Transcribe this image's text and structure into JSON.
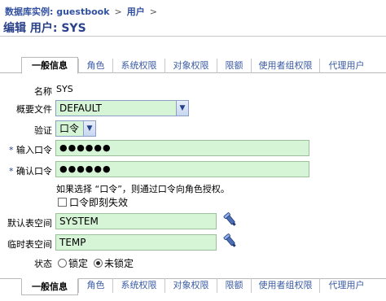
{
  "breadcrumb": {
    "items": [
      "数据库实例: guestbook",
      "用户"
    ],
    "separator": ">"
  },
  "header": {
    "title": "编辑 用户: SYS"
  },
  "tabs": [
    {
      "label": "一般信息",
      "active": true
    },
    {
      "label": "角色"
    },
    {
      "label": "系统权限"
    },
    {
      "label": "对象权限"
    },
    {
      "label": "限额"
    },
    {
      "label": "使用者组权限"
    },
    {
      "label": "代理用户"
    }
  ],
  "form": {
    "name_label": "名称",
    "name_value": "SYS",
    "profile_label": "概要文件",
    "profile_value": "DEFAULT",
    "auth_label": "验证",
    "auth_value": "口令",
    "password_label": "输入口令",
    "password_value": "●●●●●●",
    "confirm_label": "确认口令",
    "confirm_value": "●●●●●●",
    "required_marker": "*",
    "hint": "如果选择 “口令”，则通过口令向角色授权。",
    "expire_label": "口令即刻失效",
    "default_ts_label": "默认表空间",
    "default_ts_value": "SYSTEM",
    "temp_ts_label": "临时表空间",
    "temp_ts_value": "TEMP",
    "status_label": "状态",
    "status_options": [
      "锁定",
      "未锁定"
    ],
    "status_selected": "未锁定"
  },
  "icons": {
    "dropdown": "chevron-down-icon",
    "search_tablespace": "flashlight-icon"
  },
  "colors": {
    "field_bg": "#d6f4d6",
    "link": "#3a5ba3",
    "title": "#2a4289"
  }
}
